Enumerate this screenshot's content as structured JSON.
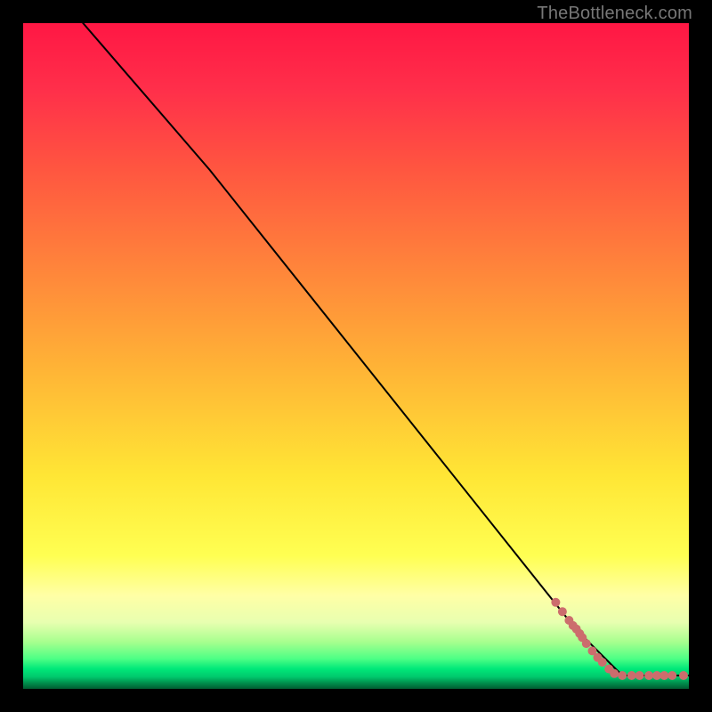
{
  "watermark": "TheBottleneck.com",
  "chart_data": {
    "type": "line",
    "title": "",
    "xlabel": "",
    "ylabel": "",
    "xlim": [
      0,
      100
    ],
    "ylim": [
      0,
      100
    ],
    "grid": false,
    "series": [
      {
        "name": "black-curve",
        "x": [
          9,
          28,
          83,
          90,
          100
        ],
        "y": [
          100,
          78,
          9,
          2,
          2
        ]
      },
      {
        "name": "red-dots",
        "x": [
          80,
          81,
          82,
          82.6,
          83.1,
          83.6,
          84,
          84.6,
          85.5,
          86.3,
          87,
          88,
          88.8,
          90,
          91.4,
          92.6,
          94,
          95.2,
          96.3,
          97.5,
          99.2
        ],
        "y": [
          13,
          11.6,
          10.3,
          9.5,
          9,
          8.3,
          7.7,
          6.8,
          5.7,
          4.7,
          4,
          3,
          2.3,
          2,
          2,
          2,
          2,
          2,
          2,
          2,
          2
        ]
      }
    ],
    "colors": {
      "curve": "#000000",
      "dots": "#cc6d6d"
    }
  }
}
